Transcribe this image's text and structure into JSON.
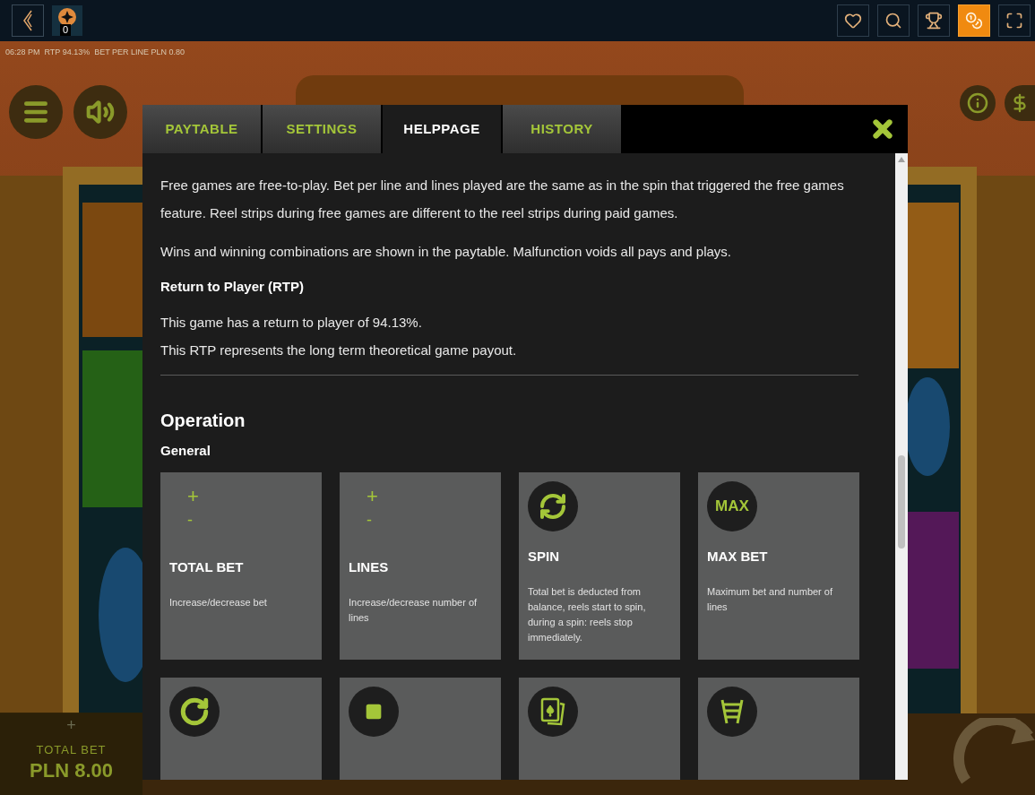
{
  "top_bar": {
    "left": [
      {
        "kind": "back"
      },
      {
        "kind": "token",
        "badge": "0"
      }
    ],
    "right": [
      {
        "kind": "heart",
        "selected": false
      },
      {
        "kind": "search",
        "selected": false
      },
      {
        "kind": "trophy",
        "selected": false
      },
      {
        "kind": "coins",
        "selected": true
      },
      {
        "kind": "fullscreen",
        "selected": false
      }
    ]
  },
  "game": {
    "status_line": "06:28 PM  RTP 94.13%  BET PER LINE PLN 0.80",
    "total_bet": {
      "plus": "+",
      "label": "TOTAL BET",
      "value": "PLN 8.00"
    }
  },
  "dialog": {
    "tabs": [
      {
        "label": "PAYTABLE",
        "selected": false
      },
      {
        "label": "SETTINGS",
        "selected": false
      },
      {
        "label": "HELPPAGE",
        "selected": true
      },
      {
        "label": "HISTORY",
        "selected": false
      }
    ],
    "blocks": [
      {
        "kind": "paragraph",
        "lines": [
          "Free games are free-to-play. Bet per line and lines played are the same as in the spin that triggered the free games feature. Reel strips during free games are different to the reel strips during paid games."
        ]
      },
      {
        "kind": "paragraph",
        "lines": [
          "Wins and winning combinations are shown in the paytable. Malfunction voids all pays and plays."
        ]
      },
      {
        "kind": "subheading",
        "text": "Return to Player (RTP)"
      },
      {
        "kind": "paragraph",
        "lines": [
          "This game has a return to player of 94.13%.",
          "This RTP represents the long term theoretical game payout."
        ]
      },
      {
        "kind": "divider"
      },
      {
        "kind": "heading",
        "text": "Operation"
      },
      {
        "kind": "subheading",
        "text": "General"
      },
      {
        "kind": "cards",
        "cards": [
          {
            "kind": "plus_minus",
            "plus": "+",
            "minus": "-",
            "title": "TOTAL BET",
            "text": "Increase/decrease bet"
          },
          {
            "kind": "plus_minus",
            "plus": "+",
            "minus": "-",
            "title": "LINES",
            "text": "Increase/decrease number of lines"
          },
          {
            "kind": "spin",
            "title": "SPIN",
            "text": "Total bet is deducted from balance, reels start to spin, during a spin: reels stop immediately."
          },
          {
            "kind": "max",
            "icon_text": "MAX",
            "title": "MAX BET",
            "text": "Maximum bet and number of lines"
          },
          {
            "kind": "autoplay"
          },
          {
            "kind": "stop"
          },
          {
            "kind": "gamble"
          },
          {
            "kind": "ladder"
          }
        ]
      }
    ]
  }
}
